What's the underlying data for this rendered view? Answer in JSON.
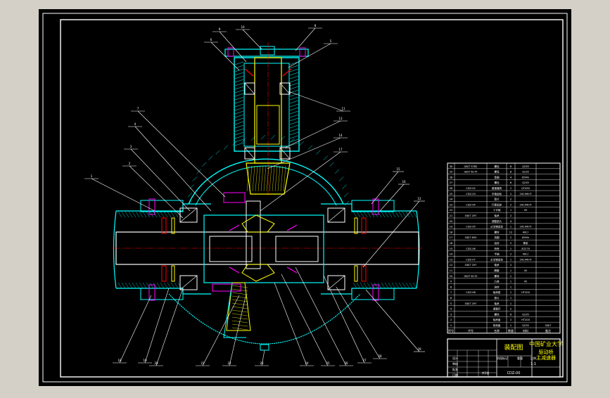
{
  "colors": {
    "window_bg": "#d4d0c8",
    "canvas_bg": "#000000",
    "frame": "#ffffff",
    "body_line": "#00ffff",
    "gear": "#ffff00",
    "flange": "#ff00ff",
    "bearing": "#ff0000",
    "leader": "#ffffff",
    "shaft": "#ffffff"
  },
  "callouts_top": [
    "9",
    "10",
    "8",
    "6",
    "5",
    "11",
    "7",
    "4",
    "13",
    "14",
    "17",
    "3",
    "2",
    "1"
  ],
  "callouts_bottom": [
    "18",
    "19",
    "20",
    "21",
    "22",
    "23",
    "24",
    "25",
    "26",
    "27",
    "28"
  ],
  "callouts_right": [
    "15",
    "16",
    "12",
    "29"
  ],
  "parts_list": {
    "rows": [
      {
        "no": "30",
        "code": "GB/T 5782",
        "name": "螺栓",
        "qty": "8",
        "mat": "Q235",
        "note": ""
      },
      {
        "no": "29",
        "code": "GB/T 6170",
        "name": "螺母",
        "qty": "8",
        "mat": "Q235",
        "note": ""
      },
      {
        "no": "28",
        "code": "",
        "name": "垫圈",
        "qty": "4",
        "mat": "65Mn",
        "note": ""
      },
      {
        "no": "27",
        "code": "",
        "name": "螺栓",
        "qty": "6",
        "mat": "Q235",
        "note": ""
      },
      {
        "no": "26",
        "code": "CDZ-02",
        "name": "差速器壳",
        "qty": "1",
        "mat": "QT450",
        "note": ""
      },
      {
        "no": "25",
        "code": "CDZ-03",
        "name": "半轴齿轮",
        "qty": "2",
        "mat": "20CrMnTi",
        "note": ""
      },
      {
        "no": "24",
        "code": "",
        "name": "垫片",
        "qty": "2",
        "mat": "",
        "note": ""
      },
      {
        "no": "23",
        "code": "CDZ-04",
        "name": "行星齿轮",
        "qty": "2",
        "mat": "20CrMnTi",
        "note": ""
      },
      {
        "no": "22",
        "code": "",
        "name": "十字轴",
        "qty": "1",
        "mat": "45",
        "note": ""
      },
      {
        "no": "21",
        "code": "GB/T 297",
        "name": "轴承",
        "qty": "2",
        "mat": "",
        "note": ""
      },
      {
        "no": "20",
        "code": "",
        "name": "调整垫片",
        "qty": "4",
        "mat": "",
        "note": ""
      },
      {
        "no": "19",
        "code": "CDZ-05",
        "name": "从动锥齿轮",
        "qty": "1",
        "mat": "20CrMnTi",
        "note": ""
      },
      {
        "no": "18",
        "code": "",
        "name": "螺栓",
        "qty": "12",
        "mat": "40Cr",
        "note": ""
      },
      {
        "no": "17",
        "code": "GB/T 893",
        "name": "挡圈",
        "qty": "2",
        "mat": "65Mn",
        "note": ""
      },
      {
        "no": "16",
        "code": "",
        "name": "油封",
        "qty": "2",
        "mat": "橡胶",
        "note": ""
      },
      {
        "no": "15",
        "code": "CDZ-06",
        "name": "桥壳",
        "qty": "1",
        "mat": "ZG270",
        "note": ""
      },
      {
        "no": "14",
        "code": "",
        "name": "半轴",
        "qty": "2",
        "mat": "40Cr",
        "note": ""
      },
      {
        "no": "13",
        "code": "CDZ-07",
        "name": "主动锥齿轮",
        "qty": "1",
        "mat": "20CrMnTi",
        "note": ""
      },
      {
        "no": "12",
        "code": "GB/T 297",
        "name": "轴承",
        "qty": "2",
        "mat": "",
        "note": ""
      },
      {
        "no": "11",
        "code": "",
        "name": "隔套",
        "qty": "1",
        "mat": "45",
        "note": ""
      },
      {
        "no": "10",
        "code": "GB/T 6170",
        "name": "螺母",
        "qty": "1",
        "mat": "",
        "note": ""
      },
      {
        "no": "9",
        "code": "",
        "name": "凸缘",
        "qty": "1",
        "mat": "45",
        "note": ""
      },
      {
        "no": "8",
        "code": "",
        "name": "油封",
        "qty": "1",
        "mat": "",
        "note": ""
      },
      {
        "no": "7",
        "code": "CDZ-08",
        "name": "轴承座",
        "qty": "1",
        "mat": "HT200",
        "note": ""
      },
      {
        "no": "6",
        "code": "",
        "name": "垫片",
        "qty": "1",
        "mat": "",
        "note": ""
      },
      {
        "no": "5",
        "code": "GB/T 297",
        "name": "轴承",
        "qty": "1",
        "mat": "",
        "note": ""
      },
      {
        "no": "4",
        "code": "",
        "name": "调整环",
        "qty": "2",
        "mat": "",
        "note": ""
      },
      {
        "no": "3",
        "code": "",
        "name": "螺栓",
        "qty": "6",
        "mat": "Q235",
        "note": ""
      },
      {
        "no": "2",
        "code": "",
        "name": "轴承盖",
        "qty": "2",
        "mat": "HT200",
        "note": ""
      },
      {
        "no": "1",
        "code": "",
        "name": "桥壳盖",
        "qty": "1",
        "mat": "Q235",
        "note": "GB/T"
      }
    ],
    "header": [
      "序号",
      "代号",
      "名称",
      "数量",
      "材料",
      "备注"
    ]
  },
  "title_block": {
    "drawing_name": "装配图",
    "school": "中国矿业大学",
    "subject_line1": "驱动桥",
    "subject_line2": "主减速器",
    "scale": "1:1",
    "sheet": "共1张",
    "drawing_no": "CDZ-00",
    "designer": "设计",
    "checker": "审核",
    "approver": "批准",
    "date": "日期",
    "stage": "阶段标记",
    "weight": "重量",
    "ratio": "比例"
  }
}
